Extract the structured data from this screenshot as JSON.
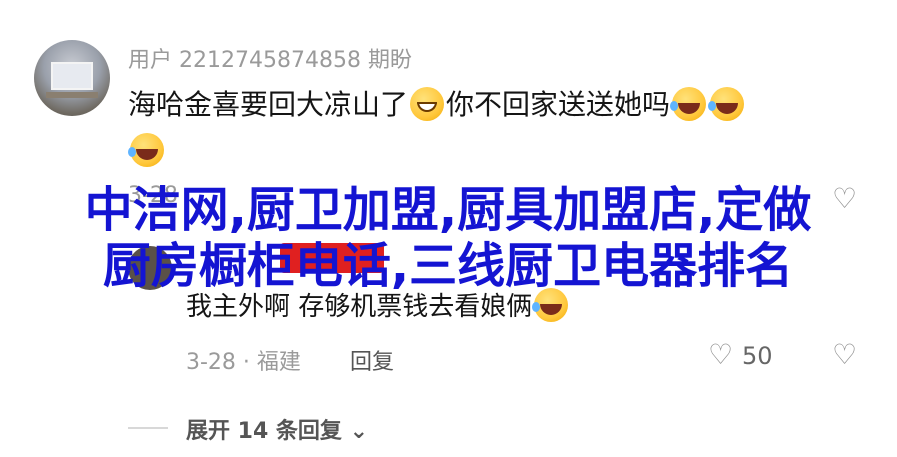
{
  "comment": {
    "username": "用户 2212745874858 期盼",
    "text_part1": "海哈金喜要回大凉山了",
    "emoji_1": "grin-emoji",
    "text_part2": "你不回家送送她吗",
    "emoji_2": "laughing-tears-emoji",
    "meta_date": "3-28"
  },
  "reply": {
    "text": "我主外啊 存够机票钱去看娘俩",
    "emoji": "laughing-tears-emoji",
    "date_location": "3-28 · 福建",
    "reply_label": "回复",
    "likes": "50"
  },
  "expand_label": "展开 14 条回复",
  "overlay": {
    "line1": "中洁网,厨卫加盟,厨具加盟店,定做",
    "line2": "厨房橱柜电话,三线厨卫电器排名"
  }
}
